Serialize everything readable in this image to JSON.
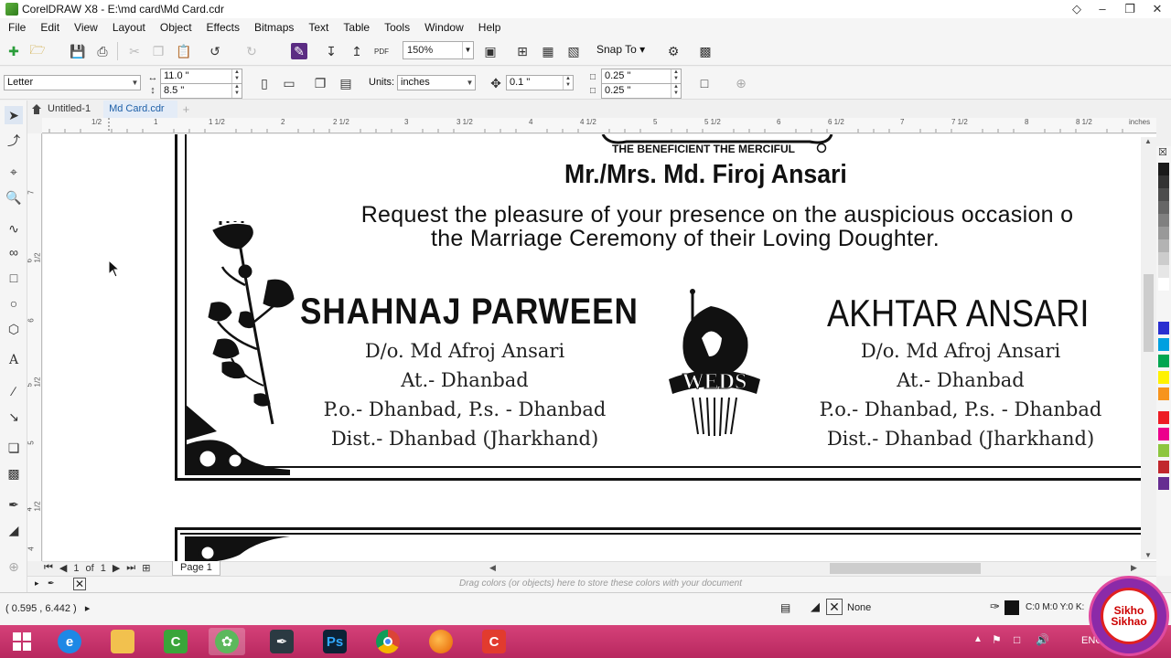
{
  "window": {
    "title": "CorelDRAW X8 - E:\\md card\\Md Card.cdr",
    "controls": [
      "minimize",
      "maximize",
      "close"
    ]
  },
  "menu": [
    "File",
    "Edit",
    "View",
    "Layout",
    "Object",
    "Effects",
    "Bitmaps",
    "Text",
    "Table",
    "Tools",
    "Window",
    "Help"
  ],
  "toolbar": {
    "zoom": "150%",
    "snap_to": "Snap To"
  },
  "property_bar": {
    "page_size": "Letter",
    "width": "11.0 \"",
    "height": "8.5 \"",
    "units_label": "Units:",
    "units": "inches",
    "nudge": "0.1 \"",
    "dup_x": "0.25 \"",
    "dup_y": "0.25 \""
  },
  "doc_tabs": [
    {
      "label": "Untitled-1",
      "active": false
    },
    {
      "label": "Md Card.cdr",
      "active": true
    }
  ],
  "ruler": {
    "h_labels": [
      "1/2",
      "1",
      "1 1/2",
      "2",
      "2 1/2",
      "3",
      "3 1/2",
      "4",
      "4 1/2",
      "5",
      "5 1/2",
      "6",
      "6 1/2",
      "7",
      "7 1/2",
      "8",
      "8 1/2",
      "inches"
    ],
    "v_labels": [
      "7",
      "6 1/2",
      "6",
      "5 1/2",
      "5",
      "4 1/2",
      "4"
    ]
  },
  "card": {
    "blessing": "THE BENEFICIENT THE MERCIFUL",
    "host": "Mr./Mrs. Md. Firoj Ansari",
    "request_line1": "Request the pleasure of your presence on the auspicious occasion o",
    "request_line2": "the Marriage Ceremony of their Loving Doughter.",
    "weds": "WEDS",
    "bride": {
      "name": "SHAHNAJ PARWEEN",
      "lines": [
        "D/o. Md  Afroj  Ansari",
        "At.- Dhanbad",
        "P.o.- Dhanbad, P.s. - Dhanbad",
        "Dist.- Dhanbad (Jharkhand)"
      ]
    },
    "groom": {
      "name": "AKHTAR ANSARI",
      "lines": [
        "D/o. Md  Afroj  Ansari",
        "At.- Dhanbad",
        "P.o.- Dhanbad, P.s. - Dhanbad",
        "Dist.- Dhanbad (Jharkhand)"
      ]
    }
  },
  "page_nav": {
    "current": "1",
    "of_label": "of",
    "total": "1",
    "page_tab": "Page 1"
  },
  "color_strip_hint": "Drag colors (or objects) here to store these colors with your document",
  "status": {
    "coords": "( 0.595 , 6.442 )",
    "fill": "None",
    "outline": "C:0 M:0 Y:0 K:"
  },
  "palette": [
    "#1a1a1a",
    "#333333",
    "#4d4d4d",
    "#666666",
    "#808080",
    "#999999",
    "#b3b3b3",
    "#cccccc",
    "#e6e6e6",
    "#ffffff",
    "#2a2fd0",
    "#00a0e0",
    "#00a651",
    "#fff200",
    "#f7941d",
    "#ed1c24",
    "#ec008c",
    "#8dc63f",
    "#c1272d",
    "#662d91"
  ],
  "taskbar": {
    "apps": [
      "start",
      "internet-explorer",
      "file-explorer",
      "coreldraw-green",
      "corel-leaf",
      "pen-tool",
      "photoshop",
      "chrome",
      "firefox",
      "coreldraw-red"
    ],
    "tray": "ENG"
  },
  "watermark": {
    "text": "Sikho Sikhao"
  }
}
